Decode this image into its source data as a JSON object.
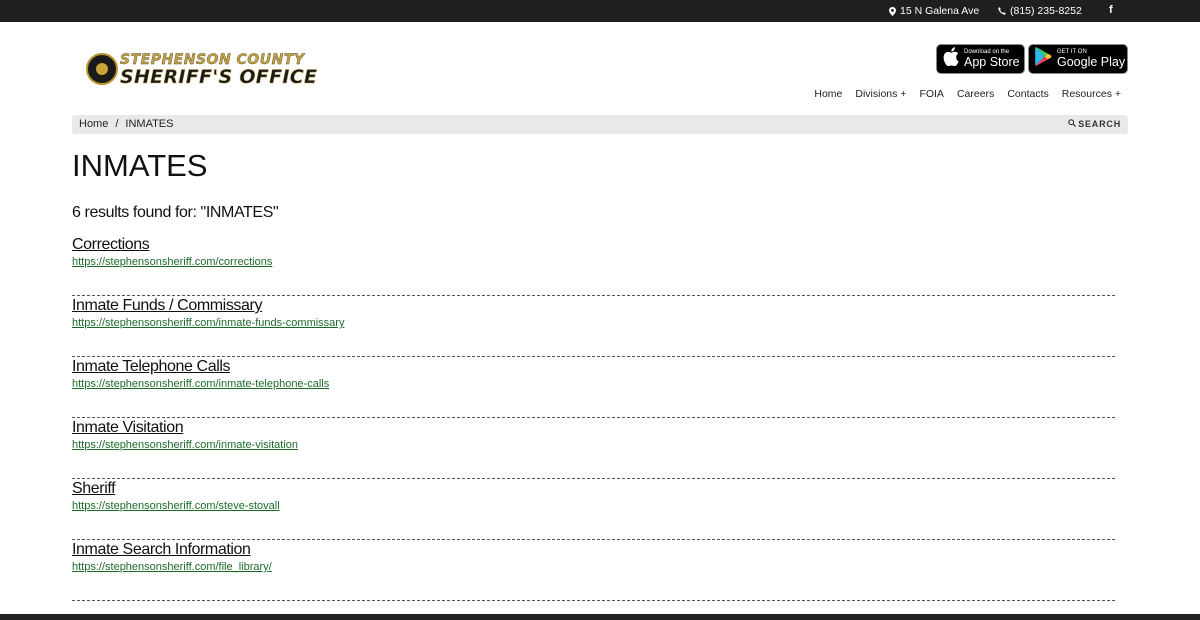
{
  "topbar": {
    "address": "15 N Galena Ave",
    "phone": "(815) 235-8252",
    "facebook": "f"
  },
  "logo": {
    "line1": "STEPHENSON COUNTY",
    "line2": "SHERIFF'S OFFICE"
  },
  "apps": {
    "apple_small": "Download on the",
    "apple_big": "App Store",
    "google_small": "GET IT ON",
    "google_big": "Google Play"
  },
  "nav": {
    "items": [
      "Home",
      "Divisions +",
      "FOIA",
      "Careers",
      "Contacts",
      "Resources +"
    ]
  },
  "breadcrumb": {
    "home": "Home",
    "separator": "/",
    "current": "INMATES",
    "search_label": "SEARCH"
  },
  "page": {
    "title": "INMATES",
    "results_count": "6 results found for: \"INMATES\""
  },
  "results": [
    {
      "title": "Corrections",
      "url": "https://stephensonsheriff.com/corrections"
    },
    {
      "title": "Inmate Funds / Commissary",
      "url": "https://stephensonsheriff.com/inmate-funds-commissary"
    },
    {
      "title": "Inmate Telephone Calls",
      "url": "https://stephensonsheriff.com/inmate-telephone-calls"
    },
    {
      "title": "Inmate Visitation",
      "url": "https://stephensonsheriff.com/inmate-visitation"
    },
    {
      "title": "Sheriff",
      "url": "https://stephensonsheriff.com/steve-stovall"
    },
    {
      "title": "Inmate Search Information",
      "url": "https://stephensonsheriff.com/file_library/"
    }
  ],
  "colors": {
    "topbar": "#1f1f1f",
    "link_green": "#1d6b2a",
    "logo_gold": "#c0a24a"
  },
  "icons": [
    "map-pin-icon",
    "phone-icon",
    "facebook-icon",
    "apple-icon",
    "google-play-icon",
    "search-icon"
  ]
}
